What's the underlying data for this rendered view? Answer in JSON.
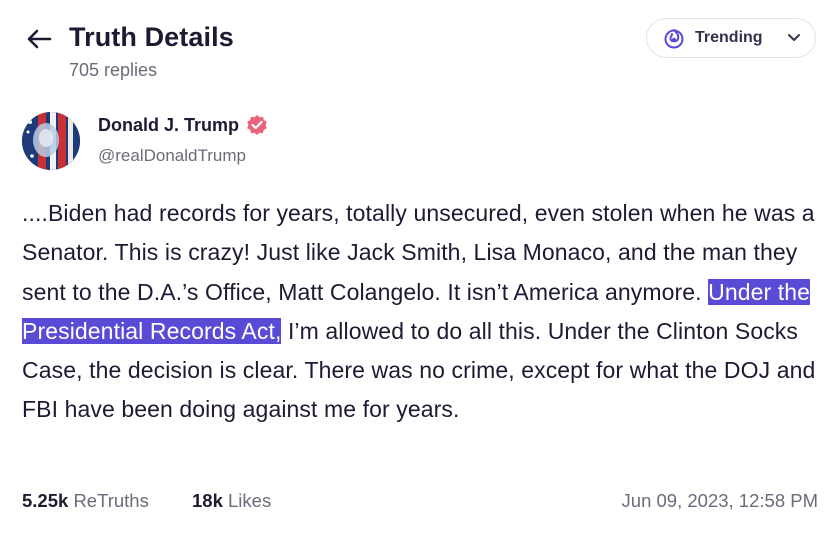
{
  "header": {
    "title": "Truth Details",
    "subtitle": "705 replies",
    "trending_label": "Trending"
  },
  "author": {
    "name": "Donald J. Trump",
    "handle": "@realDonaldTrump"
  },
  "post": {
    "text_before": "....Biden had records for years, totally unsecured, even stolen when he was a Senator. This is crazy! Just like Jack Smith, Lisa Monaco, and the man they sent to the D.A.’s Office, Matt Colangelo. It isn’t America anymore. ",
    "text_highlighted": "Under the Presidential Records Act,",
    "text_after": " I’m allowed to do all this. Under the Clinton Socks Case, the decision is clear. There was no crime, except for what the DOJ and FBI have been doing against me for years."
  },
  "stats": {
    "retruths_count": "5.25k",
    "retruths_label": "ReTruths",
    "likes_count": "18k",
    "likes_label": "Likes",
    "date": "Jun 09, 2023, 12:58 PM"
  },
  "colors": {
    "accent": "#5a4bd6",
    "verified": "#e8657d",
    "text_primary": "#1c1b33",
    "text_secondary": "#6b6b7b"
  },
  "icons": {
    "back": "arrow-left-icon",
    "trending": "flame-icon",
    "dropdown": "chevron-down-icon",
    "verified": "verified-badge-icon"
  }
}
